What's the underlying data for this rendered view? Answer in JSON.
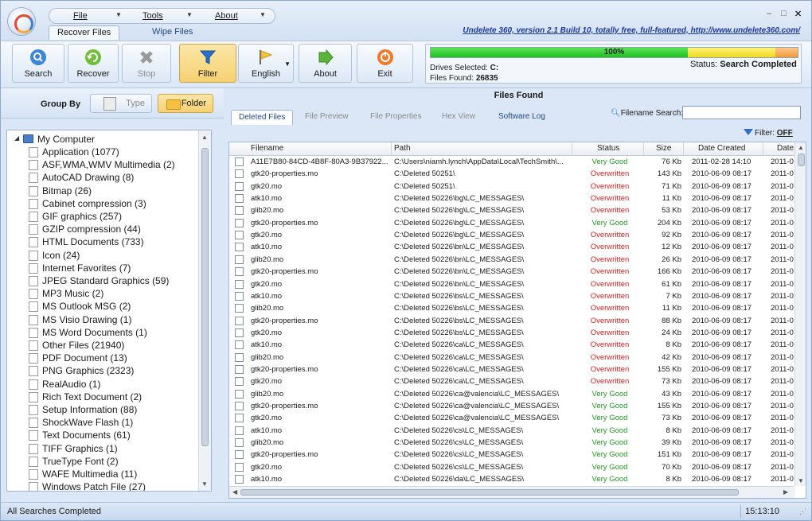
{
  "menu": {
    "file": "File",
    "tools": "Tools",
    "about": "About"
  },
  "top_tabs": [
    "Recover Files",
    "Wipe Files"
  ],
  "promo_link": "Undelete 360, version 2.1 Build 10, totally free, full-featured, http://www.undelete360.com/",
  "ribbon": {
    "search": "Search",
    "recover": "Recover",
    "stop": "Stop",
    "filter": "Filter",
    "english": "English",
    "about": "About",
    "exit": "Exit"
  },
  "status_panel": {
    "progress_percent": 100,
    "progress_text": "100%",
    "drives_label": "Drives Selected:",
    "drives_value": "C:",
    "files_found_label": "Files Found:",
    "files_found_value": "26835",
    "status_label": "Status:",
    "status_value": "Search Completed"
  },
  "group_by": {
    "label": "Group By",
    "type": "Type",
    "folder": "Folder"
  },
  "tree": {
    "root": "My Computer",
    "items": [
      "Application (1077)",
      "ASF,WMA,WMV Multimedia (2)",
      "AutoCAD Drawing (8)",
      "Bitmap (26)",
      "Cabinet compression (3)",
      "GIF graphics (257)",
      "GZIP compression (44)",
      "HTML Documents (733)",
      "Icon (24)",
      "Internet Favorites (7)",
      "JPEG Standard Graphics (59)",
      "MP3 Music (2)",
      "MS Outlook MSG (2)",
      "MS Visio Drawing (1)",
      "MS Word Documents (1)",
      "Other Files (21940)",
      "PDF Document (13)",
      "PNG Graphics (2323)",
      "RealAudio (1)",
      "Rich Text Document (2)",
      "Setup Information (88)",
      "ShockWave Flash (1)",
      "Text Documents (61)",
      "TIFF Graphics (1)",
      "TrueType Font (2)",
      "WAFE Multimedia (11)",
      "Windows Patch File (27)"
    ]
  },
  "files_panel": {
    "title": "Files Found",
    "tabs": [
      "Deleted Files",
      "File Preview",
      "File Properties",
      "Hex View",
      "Software Log"
    ],
    "search_label": "Filename Search:",
    "search_value": "",
    "filter_label": "Filter:",
    "filter_value": "OFF",
    "columns": [
      "Filename",
      "Path",
      "Status",
      "Size",
      "Date Created",
      "Date"
    ],
    "rows": [
      [
        "A11E7B80-84CD-4B8F-80A3-9B37922...",
        "C:\\Users\\niamh.lynch\\AppData\\Local\\TechSmith\\...",
        "Very Good",
        "76 Kb",
        "2011-02-28 14:10",
        "2011-0"
      ],
      [
        "gtk20-properties.mo",
        "C:\\Deleted 50251\\",
        "Overwritten",
        "143 Kb",
        "2010-06-09 08:17",
        "2011-0"
      ],
      [
        "gtk20.mo",
        "C:\\Deleted 50251\\",
        "Overwritten",
        "71 Kb",
        "2010-06-09 08:17",
        "2011-0"
      ],
      [
        "atk10.mo",
        "C:\\Deleted 50226\\bg\\LC_MESSAGES\\",
        "Overwritten",
        "11 Kb",
        "2010-06-09 08:17",
        "2011-0"
      ],
      [
        "glib20.mo",
        "C:\\Deleted 50226\\bg\\LC_MESSAGES\\",
        "Overwritten",
        "53 Kb",
        "2010-06-09 08:17",
        "2011-0"
      ],
      [
        "gtk20-properties.mo",
        "C:\\Deleted 50226\\bg\\LC_MESSAGES\\",
        "Very Good",
        "204 Kb",
        "2010-06-09 08:17",
        "2011-0"
      ],
      [
        "gtk20.mo",
        "C:\\Deleted 50226\\bg\\LC_MESSAGES\\",
        "Overwritten",
        "92 Kb",
        "2010-06-09 08:17",
        "2011-0"
      ],
      [
        "atk10.mo",
        "C:\\Deleted 50226\\bn\\LC_MESSAGES\\",
        "Overwritten",
        "12 Kb",
        "2010-06-09 08:17",
        "2011-0"
      ],
      [
        "glib20.mo",
        "C:\\Deleted 50226\\bn\\LC_MESSAGES\\",
        "Overwritten",
        "26 Kb",
        "2010-06-09 08:17",
        "2011-0"
      ],
      [
        "gtk20-properties.mo",
        "C:\\Deleted 50226\\bn\\LC_MESSAGES\\",
        "Overwritten",
        "166 Kb",
        "2010-06-09 08:17",
        "2011-0"
      ],
      [
        "gtk20.mo",
        "C:\\Deleted 50226\\bn\\LC_MESSAGES\\",
        "Overwritten",
        "61 Kb",
        "2010-06-09 08:17",
        "2011-0"
      ],
      [
        "atk10.mo",
        "C:\\Deleted 50226\\bs\\LC_MESSAGES\\",
        "Overwritten",
        "7 Kb",
        "2010-06-09 08:17",
        "2011-0"
      ],
      [
        "glib20.mo",
        "C:\\Deleted 50226\\bs\\LC_MESSAGES\\",
        "Overwritten",
        "11 Kb",
        "2010-06-09 08:17",
        "2011-0"
      ],
      [
        "gtk20-properties.mo",
        "C:\\Deleted 50226\\bs\\LC_MESSAGES\\",
        "Overwritten",
        "88 Kb",
        "2010-06-09 08:17",
        "2011-0"
      ],
      [
        "gtk20.mo",
        "C:\\Deleted 50226\\bs\\LC_MESSAGES\\",
        "Overwritten",
        "24 Kb",
        "2010-06-09 08:17",
        "2011-0"
      ],
      [
        "atk10.mo",
        "C:\\Deleted 50226\\ca\\LC_MESSAGES\\",
        "Overwritten",
        "8 Kb",
        "2010-06-09 08:17",
        "2011-0"
      ],
      [
        "glib20.mo",
        "C:\\Deleted 50226\\ca\\LC_MESSAGES\\",
        "Overwritten",
        "42 Kb",
        "2010-06-09 08:17",
        "2011-0"
      ],
      [
        "gtk20-properties.mo",
        "C:\\Deleted 50226\\ca\\LC_MESSAGES\\",
        "Overwritten",
        "155 Kb",
        "2010-06-09 08:17",
        "2011-0"
      ],
      [
        "gtk20.mo",
        "C:\\Deleted 50226\\ca\\LC_MESSAGES\\",
        "Overwritten",
        "73 Kb",
        "2010-06-09 08:17",
        "2011-0"
      ],
      [
        "glib20.mo",
        "C:\\Deleted 50226\\ca@valencia\\LC_MESSAGES\\",
        "Very Good",
        "43 Kb",
        "2010-06-09 08:17",
        "2011-0"
      ],
      [
        "gtk20-properties.mo",
        "C:\\Deleted 50226\\ca@valencia\\LC_MESSAGES\\",
        "Very Good",
        "155 Kb",
        "2010-06-09 08:17",
        "2011-0"
      ],
      [
        "gtk20.mo",
        "C:\\Deleted 50226\\ca@valencia\\LC_MESSAGES\\",
        "Very Good",
        "73 Kb",
        "2010-06-09 08:17",
        "2011-0"
      ],
      [
        "atk10.mo",
        "C:\\Deleted 50226\\cs\\LC_MESSAGES\\",
        "Very Good",
        "8 Kb",
        "2010-06-09 08:17",
        "2011-0"
      ],
      [
        "glib20.mo",
        "C:\\Deleted 50226\\cs\\LC_MESSAGES\\",
        "Very Good",
        "39 Kb",
        "2010-06-09 08:17",
        "2011-0"
      ],
      [
        "gtk20-properties.mo",
        "C:\\Deleted 50226\\cs\\LC_MESSAGES\\",
        "Very Good",
        "151 Kb",
        "2010-06-09 08:17",
        "2011-0"
      ],
      [
        "gtk20.mo",
        "C:\\Deleted 50226\\cs\\LC_MESSAGES\\",
        "Very Good",
        "70 Kb",
        "2010-06-09 08:17",
        "2011-0"
      ],
      [
        "atk10.mo",
        "C:\\Deleted 50226\\da\\LC_MESSAGES\\",
        "Very Good",
        "8 Kb",
        "2010-06-09 08:17",
        "2011-0"
      ]
    ]
  },
  "statusbar": {
    "message": "All Searches Completed",
    "time": "15:13:10"
  },
  "colors": {
    "status_good": "#1f9a1f",
    "status_overwritten": "#d42020",
    "accent": "#1f4a80"
  }
}
